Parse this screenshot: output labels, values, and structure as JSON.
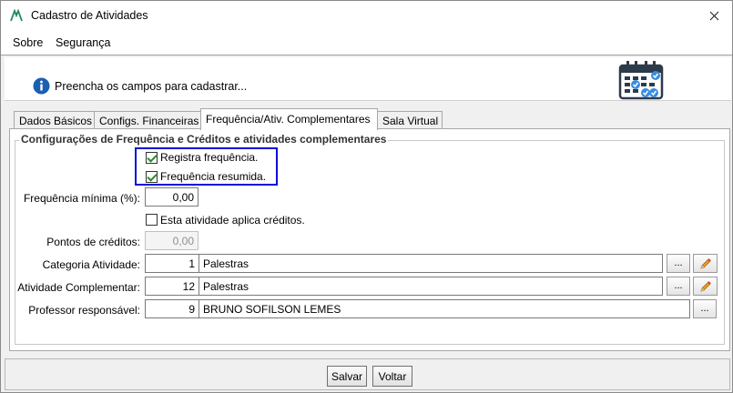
{
  "window": {
    "title": "Cadastro de Atividades"
  },
  "menu": {
    "items": [
      "Sobre",
      "Segurança"
    ]
  },
  "header": {
    "message": "Preencha os campos para cadastrar..."
  },
  "tabs": [
    {
      "label": "Dados Básicos"
    },
    {
      "label": "Configs. Financeiras"
    },
    {
      "label": "Frequência/Ativ. Complementares"
    },
    {
      "label": "Sala Virtual"
    }
  ],
  "group": {
    "title": "Configurações de Frequência e Créditos e atividades complementares"
  },
  "form": {
    "registra_frequencia": {
      "label": "Registra frequência.",
      "checked": true
    },
    "frequencia_resumida": {
      "label": "Frequência resumida.",
      "checked": true
    },
    "frequencia_minima": {
      "label": "Frequência mínima (%):",
      "value": "0,00"
    },
    "aplica_creditos": {
      "label": "Esta atividade aplica créditos.",
      "checked": false
    },
    "pontos_creditos": {
      "label": "Pontos de créditos:",
      "value": "0,00"
    },
    "categoria": {
      "label": "Categoria Atividade:",
      "code": "1",
      "name": "Palestras",
      "button": "..."
    },
    "complementar": {
      "label": "Atividade Complementar:",
      "code": "12",
      "name": "Palestras",
      "button": "..."
    },
    "professor": {
      "label": "Professor responsável:",
      "code": "9",
      "name": "BRUNO SOFILSON LEMES",
      "button": "..."
    }
  },
  "footer": {
    "save_label": "Salvar",
    "back_label": "Voltar"
  },
  "colors": {
    "highlight": "#0010d8",
    "check": "#2a8a2a",
    "info_blue": "#1a5fb4"
  }
}
